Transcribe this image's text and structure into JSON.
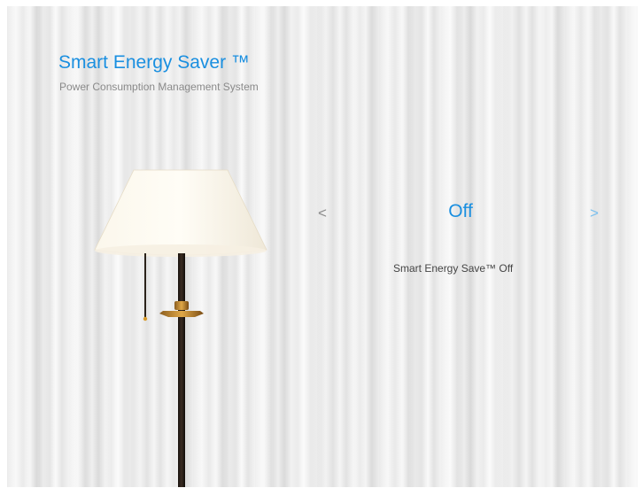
{
  "header": {
    "title": "Smart Energy Saver ™",
    "subtitle": "Power Consumption Management System"
  },
  "selector": {
    "prev_label": "<",
    "next_label": ">",
    "current_mode": "Off",
    "description": "Smart Energy Save™ Off"
  },
  "illustration": {
    "icon": "floor-lamp-icon"
  },
  "colors": {
    "accent": "#1a8fe0",
    "next_arrow": "#7cc0ee",
    "prev_arrow": "#8d8d8d",
    "subtitle": "#8a8a8a"
  }
}
